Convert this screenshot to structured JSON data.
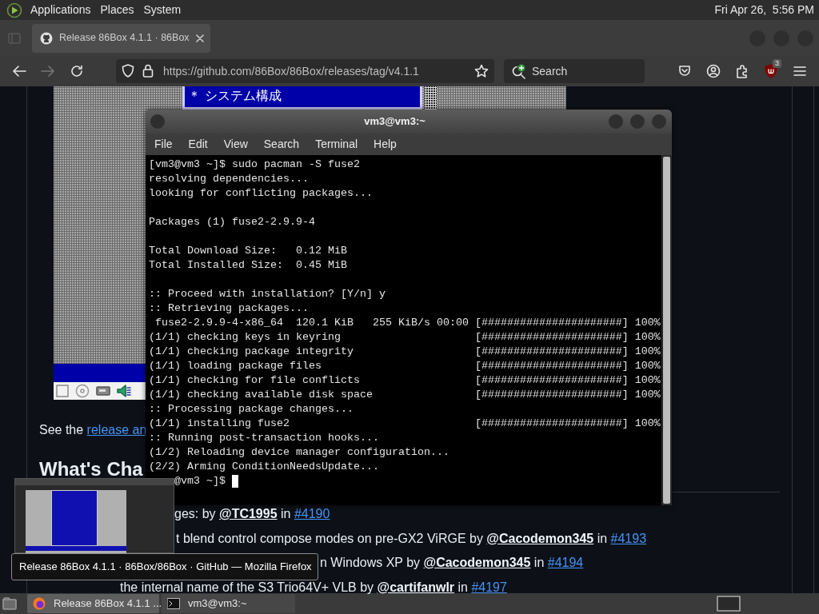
{
  "top_panel": {
    "menus": [
      "Applications",
      "Places",
      "System"
    ],
    "clock": "Fri Apr 26,  5:56 PM"
  },
  "browser": {
    "tabs": [
      {
        "title": "Release 86Box 4.1.1 · 86Box",
        "selected": true
      }
    ],
    "address": "https://github.com/86Box/86Box/releases/tag/v4.1.1",
    "search": {
      "placeholder": "Search"
    },
    "extension_badge": "3",
    "page": {
      "embedded_screenshot": {
        "menu_item": "＊ システム構成"
      },
      "intro": {
        "text": "See the ",
        "link": "release an"
      },
      "heading": "What's Cha",
      "items": [
        [
          {
            "kind": "text",
            "text": "ges: by "
          },
          {
            "kind": "mention",
            "text": "@TC1995"
          },
          {
            "kind": "text",
            "text": " in "
          },
          {
            "kind": "issue",
            "text": "#4190"
          }
        ],
        [
          {
            "kind": "text",
            "text": "t blend control compose modes on pre-GX2 ViRGE by "
          },
          {
            "kind": "mention",
            "text": "@Cacodemon345"
          },
          {
            "kind": "text",
            "text": " in "
          },
          {
            "kind": "issue",
            "text": "#4193"
          }
        ],
        [
          {
            "kind": "text",
            "text": "n Windows XP by "
          },
          {
            "kind": "mention",
            "text": "@Cacodemon345"
          },
          {
            "kind": "text",
            "text": " in "
          },
          {
            "kind": "issue",
            "text": "#4194"
          }
        ],
        [
          {
            "kind": "text",
            "text": "the internal name of the S3 Trio64V+ VLB by "
          },
          {
            "kind": "mention",
            "text": "@cartifanwlr"
          },
          {
            "kind": "text",
            "text": " in "
          },
          {
            "kind": "issue",
            "text": "#4197"
          }
        ]
      ]
    }
  },
  "terminal": {
    "title": "vm3@vm3:~",
    "menu": [
      "File",
      "Edit",
      "View",
      "Search",
      "Terminal",
      "Help"
    ],
    "blocks": [
      [
        {
          "text": "[vm3@vm3 ~]$ sudo pacman -S fuse2"
        },
        {
          "text": "resolving dependencies..."
        },
        {
          "text": "looking for conflicting packages..."
        }
      ],
      [
        {
          "text": "Packages (1) fuse2-2.9.9-4"
        }
      ],
      [
        {
          "text": "Total Download Size:   0.12 MiB"
        },
        {
          "text": "Total Installed Size:  0.45 MiB"
        }
      ],
      [
        {
          "text": ":: Proceed with installation? [Y/n] y"
        },
        {
          "text": ":: Retrieving packages..."
        },
        {
          "text": " fuse2-2.9.9-4-x86_64  120.1 KiB   255 KiB/s 00:00",
          "progress": "[######################] 100%"
        },
        {
          "text": "(1/1) checking keys in keyring",
          "progress": "[######################] 100%"
        },
        {
          "text": "(1/1) checking package integrity",
          "progress": "[######################] 100%"
        },
        {
          "text": "(1/1) loading package files",
          "progress": "[######################] 100%"
        },
        {
          "text": "(1/1) checking for file conflicts",
          "progress": "[######################] 100%"
        },
        {
          "text": "(1/1) checking available disk space",
          "progress": "[######################] 100%"
        },
        {
          "text": ":: Processing package changes..."
        },
        {
          "text": "(1/1) installing fuse2",
          "progress": "[######################] 100%"
        },
        {
          "text": ":: Running post-transaction hooks..."
        },
        {
          "text": "(1/2) Reloading device manager configuration..."
        },
        {
          "text": "(2/2) Arming ConditionNeedsUpdate..."
        }
      ]
    ],
    "prompt": "@vm3 ~]$"
  },
  "tooltip": "Release 86Box 4.1.1 · 86Box/86Box · GitHub — Mozilla Firefox",
  "taskbar": {
    "tasks": [
      {
        "title": "Release 86Box 4.1.1 ...",
        "kind": "browser",
        "selected": true
      },
      {
        "title": "vm3@vm3:~",
        "kind": "terminal",
        "selected": false
      }
    ]
  }
}
